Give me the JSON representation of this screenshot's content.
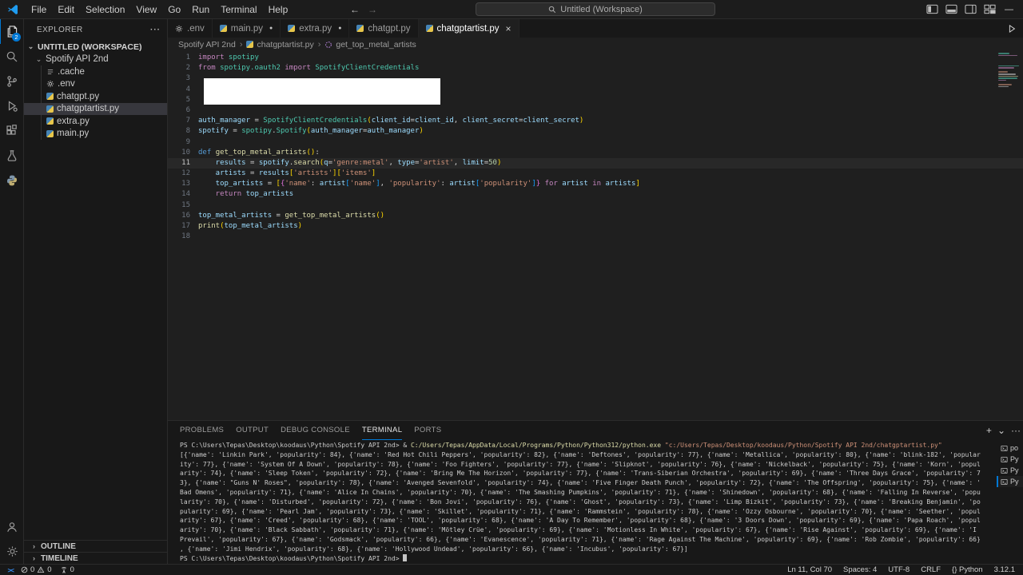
{
  "titlebar": {
    "menus": [
      "File",
      "Edit",
      "Selection",
      "View",
      "Go",
      "Run",
      "Terminal",
      "Help"
    ],
    "back_arrow": "←",
    "forward_arrow": "→",
    "search_label": "Untitled (Workspace)",
    "minimize_glyph": "—"
  },
  "activity_bar": {
    "items": [
      {
        "name": "explorer",
        "active": true,
        "badge": "2"
      },
      {
        "name": "search"
      },
      {
        "name": "source-control"
      },
      {
        "name": "run-debug"
      },
      {
        "name": "extensions"
      },
      {
        "name": "testing"
      },
      {
        "name": "python"
      }
    ],
    "bottom_items": [
      {
        "name": "account"
      },
      {
        "name": "settings"
      }
    ]
  },
  "sidebar": {
    "title": "EXPLORER",
    "more_actions": "···",
    "workspace": "UNTITLED (WORKSPACE)",
    "folder": "Spotify API 2nd",
    "files": [
      {
        "name": ".cache",
        "icon": "file"
      },
      {
        "name": ".env",
        "icon": "gear"
      },
      {
        "name": "chatgpt.py",
        "icon": "python"
      },
      {
        "name": "chatgptartist.py",
        "icon": "python",
        "selected": true
      },
      {
        "name": "extra.py",
        "icon": "python"
      },
      {
        "name": "main.py",
        "icon": "python"
      }
    ],
    "sections": [
      "OUTLINE",
      "TIMELINE"
    ]
  },
  "tabs": [
    {
      "label": ".env",
      "icon": "gear"
    },
    {
      "label": "main.py",
      "icon": "python",
      "modified": true
    },
    {
      "label": "extra.py",
      "icon": "python",
      "modified": true
    },
    {
      "label": "chatgpt.py",
      "icon": "python"
    },
    {
      "label": "chatgptartist.py",
      "icon": "python",
      "active": true,
      "close": "×"
    }
  ],
  "breadcrumb": [
    "Spotify API 2nd",
    "chatgptartist.py",
    "get_top_metal_artists"
  ],
  "editor": {
    "active_line": 11,
    "lines": [
      [
        [
          "import",
          "k"
        ],
        [
          " spotipy",
          "cls"
        ]
      ],
      [
        [
          "from",
          "k"
        ],
        [
          " spotipy.oauth2",
          "cls"
        ],
        [
          " import",
          "k"
        ],
        [
          " SpotifyClientCredentials",
          "cls"
        ]
      ],
      [],
      [],
      [],
      [],
      [
        [
          "auth_manager",
          "v"
        ],
        [
          " = ",
          "p"
        ],
        [
          "SpotifyClientCredentials",
          "cls"
        ],
        [
          "(",
          "b1"
        ],
        [
          "client_id",
          "v"
        ],
        [
          "=",
          "p"
        ],
        [
          "client_id",
          "v"
        ],
        [
          ", ",
          "p"
        ],
        [
          "client_secret",
          "v"
        ],
        [
          "=",
          "p"
        ],
        [
          "client_secret",
          "v"
        ],
        [
          ")",
          "b1"
        ]
      ],
      [
        [
          "spotify",
          "v"
        ],
        [
          " = ",
          "p"
        ],
        [
          "spotipy",
          "cls"
        ],
        [
          ".",
          "p"
        ],
        [
          "Spotify",
          "cls"
        ],
        [
          "(",
          "b1"
        ],
        [
          "auth_manager",
          "v"
        ],
        [
          "=",
          "p"
        ],
        [
          "auth_manager",
          "v"
        ],
        [
          ")",
          "b1"
        ]
      ],
      [],
      [
        [
          "def",
          "kb"
        ],
        [
          " ",
          "p"
        ],
        [
          "get_top_metal_artists",
          "fn"
        ],
        [
          "(",
          "b1"
        ],
        [
          ")",
          "b1"
        ],
        [
          ":",
          "p"
        ]
      ],
      [
        [
          "    results",
          "v"
        ],
        [
          " = ",
          "p"
        ],
        [
          "spotify",
          "v"
        ],
        [
          ".",
          "p"
        ],
        [
          "search",
          "fn"
        ],
        [
          "(",
          "b1"
        ],
        [
          "q",
          "v"
        ],
        [
          "=",
          "p"
        ],
        [
          "'genre:metal'",
          "s"
        ],
        [
          ", ",
          "p"
        ],
        [
          "type",
          "v"
        ],
        [
          "=",
          "p"
        ],
        [
          "'artist'",
          "s"
        ],
        [
          ", ",
          "p"
        ],
        [
          "limit",
          "v"
        ],
        [
          "=",
          "p"
        ],
        [
          "50",
          "n"
        ],
        [
          ")",
          "b1"
        ]
      ],
      [
        [
          "    artists",
          "v"
        ],
        [
          " = ",
          "p"
        ],
        [
          "results",
          "v"
        ],
        [
          "[",
          "b1"
        ],
        [
          "'artists'",
          "s"
        ],
        [
          "]",
          "b1"
        ],
        [
          "[",
          "b1"
        ],
        [
          "'items'",
          "s"
        ],
        [
          "]",
          "b1"
        ]
      ],
      [
        [
          "    top_artists",
          "v"
        ],
        [
          " = ",
          "p"
        ],
        [
          "[",
          "b1"
        ],
        [
          "{",
          "b2"
        ],
        [
          "'name'",
          "s"
        ],
        [
          ": ",
          "p"
        ],
        [
          "artist",
          "v"
        ],
        [
          "[",
          "b3"
        ],
        [
          "'name'",
          "s"
        ],
        [
          "]",
          "b3"
        ],
        [
          ", ",
          "p"
        ],
        [
          "'popularity'",
          "s"
        ],
        [
          ": ",
          "p"
        ],
        [
          "artist",
          "v"
        ],
        [
          "[",
          "b3"
        ],
        [
          "'popularity'",
          "s"
        ],
        [
          "]",
          "b3"
        ],
        [
          "}",
          "b2"
        ],
        [
          " ",
          "p"
        ],
        [
          "for",
          "k"
        ],
        [
          " artist ",
          "v"
        ],
        [
          "in",
          "k"
        ],
        [
          " artists",
          "v"
        ],
        [
          "]",
          "b1"
        ]
      ],
      [
        [
          "    return",
          "k"
        ],
        [
          " top_artists",
          "v"
        ]
      ],
      [],
      [
        [
          "top_metal_artists",
          "v"
        ],
        [
          " = ",
          "p"
        ],
        [
          "get_top_metal_artists",
          "fn"
        ],
        [
          "()",
          "b1"
        ]
      ],
      [
        [
          "print",
          "fn"
        ],
        [
          "(",
          "b1"
        ],
        [
          "top_metal_artists",
          "v"
        ],
        [
          ")",
          "b1"
        ]
      ],
      []
    ]
  },
  "panel": {
    "tabs": [
      "PROBLEMS",
      "OUTPUT",
      "DEBUG CONSOLE",
      "TERMINAL",
      "PORTS"
    ],
    "active_tab": "TERMINAL",
    "actions": [
      "+",
      "⌄",
      "···"
    ],
    "terminal_list": [
      "po",
      "Py",
      "Py",
      "Py"
    ],
    "terminal_list_selected": 3,
    "terminal": {
      "command": [
        [
          "PS C:\\Users\\Tepas\\Desktop\\koodaus\\Python\\Spotify API 2nd> & ",
          "t-p"
        ],
        [
          "C:/Users/Tepas/AppData/Local/Programs/Python/Python312/python.exe",
          "t-y"
        ],
        [
          " ",
          "t-p"
        ],
        [
          "\"c:/Users/Tepas/Desktop/koodaus/Python/Spotify API 2nd/chatgptartist.py\"",
          "t-r"
        ]
      ],
      "output": [
        "[{'name': 'Linkin Park', 'popularity': 84}, {'name': 'Red Hot Chili Peppers', 'popularity': 82}, {'name': 'Deftones', 'popularity': 77}, {'name': 'Metallica', 'popularity': 80}, {'name': 'blink-182', 'popular",
        "ity': 77}, {'name': 'System Of A Down', 'popularity': 78}, {'name': 'Foo Fighters', 'popularity': 77}, {'name': 'Slipknot', 'popularity': 76}, {'name': 'Nickelback', 'popularity': 75}, {'name': 'Korn', 'popul",
        "arity': 74}, {'name': 'Sleep Token', 'popularity': 72}, {'name': 'Bring Me The Horizon', 'popularity': 77}, {'name': 'Trans-Siberian Orchestra', 'popularity': 69}, {'name': 'Three Days Grace', 'popularity': 7",
        "3}, {'name': \"Guns N' Roses\", 'popularity': 78}, {'name': 'Avenged Sevenfold', 'popularity': 74}, {'name': 'Five Finger Death Punch', 'popularity': 72}, {'name': 'The Offspring', 'popularity': 75}, {'name': '",
        "Bad Omens', 'popularity': 71}, {'name': 'Alice In Chains', 'popularity': 70}, {'name': 'The Smashing Pumpkins', 'popularity': 71}, {'name': 'Shinedown', 'popularity': 68}, {'name': 'Falling In Reverse', 'popu",
        "larity': 70}, {'name': 'Disturbed', 'popularity': 72}, {'name': 'Bon Jovi', 'popularity': 76}, {'name': 'Ghost', 'popularity': 73}, {'name': 'Limp Bizkit', 'popularity': 73}, {'name': 'Breaking Benjamin', 'po",
        "pularity': 69}, {'name': 'Pearl Jam', 'popularity': 73}, {'name': 'Skillet', 'popularity': 71}, {'name': 'Rammstein', 'popularity': 78}, {'name': 'Ozzy Osbourne', 'popularity': 70}, {'name': 'Seether', 'popul",
        "arity': 67}, {'name': 'Creed', 'popularity': 68}, {'name': 'TOOL', 'popularity': 68}, {'name': 'A Day To Remember', 'popularity': 68}, {'name': '3 Doors Down', 'popularity': 69}, {'name': 'Papa Roach', 'popul",
        "arity': 70}, {'name': 'Black Sabbath', 'popularity': 71}, {'name': 'Mötley Crüe', 'popularity': 69}, {'name': 'Motionless In White', 'popularity': 67}, {'name': 'Rise Against', 'popularity': 69}, {'name': 'I",
        "Prevail', 'popularity': 67}, {'name': 'Godsmack', 'popularity': 66}, {'name': 'Evanescence', 'popularity': 71}, {'name': 'Rage Against The Machine', 'popularity': 69}, {'name': 'Rob Zombie', 'popularity': 66}",
        ", {'name': 'Jimi Hendrix', 'popularity': 68}, {'name': 'Hollywood Undead', 'popularity': 66}, {'name': 'Incubus', 'popularity': 67}]"
      ],
      "prompt": "PS C:\\Users\\Tepas\\Desktop\\koodaus\\Python\\Spotify API 2nd> "
    }
  },
  "status_bar": {
    "remote_glyph": "><",
    "errors": "0",
    "warnings": "0",
    "ports": "0",
    "right": [
      "Ln 11, Col 70",
      "Spaces: 4",
      "UTF-8",
      "CRLF",
      "{} Python",
      "3.12.1"
    ]
  },
  "colors": {
    "accent": "#0078d4",
    "editor_bg": "#1f1f1f",
    "chrome_bg": "#181818"
  }
}
